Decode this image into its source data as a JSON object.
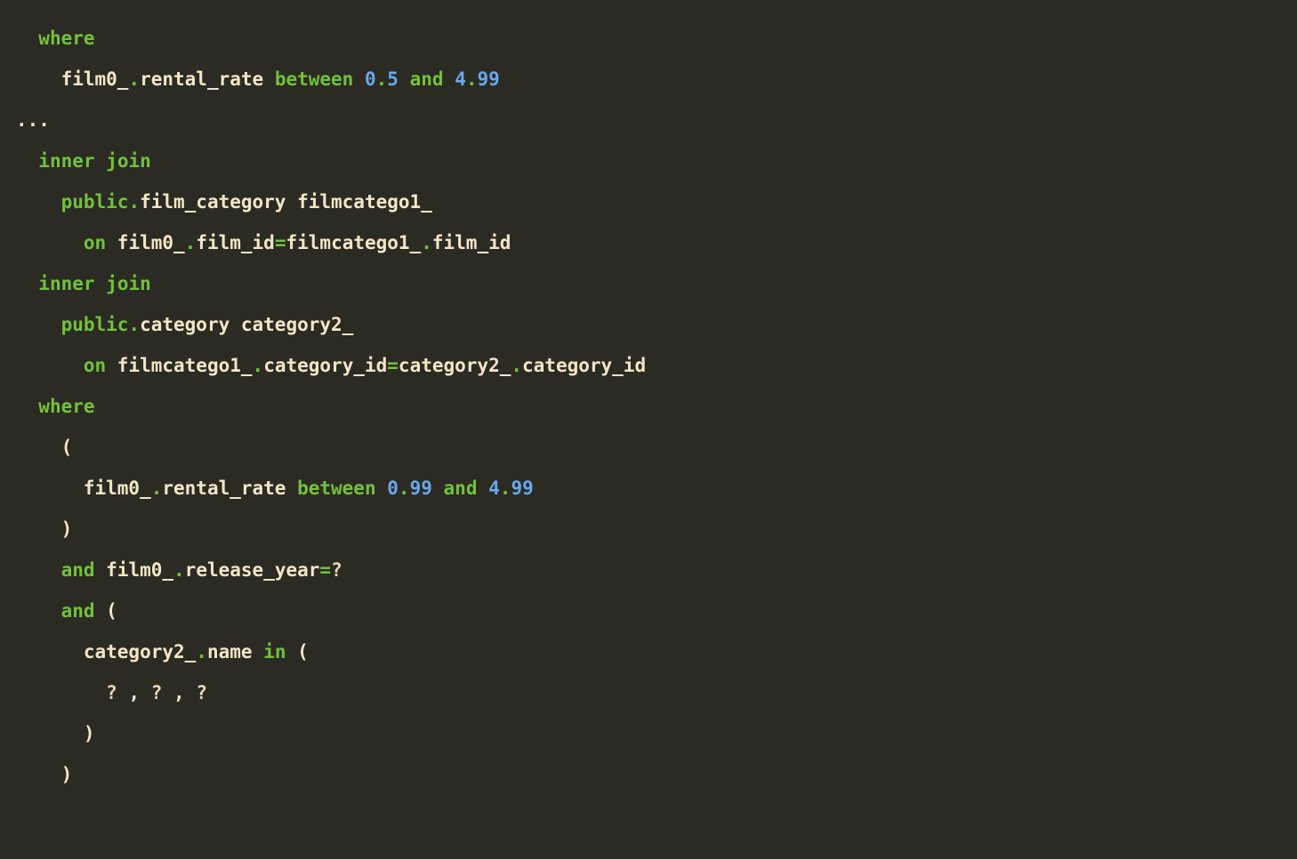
{
  "colors": {
    "bg": "#2b2b24",
    "text": "#e6dfc7",
    "keyword": "#72c23a",
    "number": "#6aa8ec"
  },
  "code_tokens": [
    [
      {
        "t": "  ",
        "c": "pn"
      },
      {
        "t": "where",
        "c": "kw"
      }
    ],
    [
      {
        "t": "    film0_",
        "c": "pn"
      },
      {
        "t": ".",
        "c": "kw"
      },
      {
        "t": "rental_rate ",
        "c": "pn"
      },
      {
        "t": "between",
        "c": "kw"
      },
      {
        "t": " ",
        "c": "pn"
      },
      {
        "t": "0",
        "c": "num"
      },
      {
        "t": ".",
        "c": "kw"
      },
      {
        "t": "5",
        "c": "num"
      },
      {
        "t": " ",
        "c": "pn"
      },
      {
        "t": "and",
        "c": "kw"
      },
      {
        "t": " ",
        "c": "pn"
      },
      {
        "t": "4",
        "c": "num"
      },
      {
        "t": ".",
        "c": "kw"
      },
      {
        "t": "99",
        "c": "num"
      }
    ],
    [
      {
        "t": "...",
        "c": "pn"
      }
    ],
    [
      {
        "t": "  ",
        "c": "pn"
      },
      {
        "t": "inner",
        "c": "kw"
      },
      {
        "t": " ",
        "c": "pn"
      },
      {
        "t": "join",
        "c": "kw"
      }
    ],
    [
      {
        "t": "    ",
        "c": "pn"
      },
      {
        "t": "public",
        "c": "kw"
      },
      {
        "t": ".",
        "c": "kw"
      },
      {
        "t": "film_category filmcatego1_",
        "c": "pn"
      }
    ],
    [
      {
        "t": "      ",
        "c": "pn"
      },
      {
        "t": "on",
        "c": "kw"
      },
      {
        "t": " film0_",
        "c": "pn"
      },
      {
        "t": ".",
        "c": "kw"
      },
      {
        "t": "film_id",
        "c": "pn"
      },
      {
        "t": "=",
        "c": "kw"
      },
      {
        "t": "filmcatego1_",
        "c": "pn"
      },
      {
        "t": ".",
        "c": "kw"
      },
      {
        "t": "film_id",
        "c": "pn"
      }
    ],
    [
      {
        "t": "  ",
        "c": "pn"
      },
      {
        "t": "inner",
        "c": "kw"
      },
      {
        "t": " ",
        "c": "pn"
      },
      {
        "t": "join",
        "c": "kw"
      }
    ],
    [
      {
        "t": "    ",
        "c": "pn"
      },
      {
        "t": "public",
        "c": "kw"
      },
      {
        "t": ".",
        "c": "kw"
      },
      {
        "t": "category category2_",
        "c": "pn"
      }
    ],
    [
      {
        "t": "      ",
        "c": "pn"
      },
      {
        "t": "on",
        "c": "kw"
      },
      {
        "t": " filmcatego1_",
        "c": "pn"
      },
      {
        "t": ".",
        "c": "kw"
      },
      {
        "t": "category_id",
        "c": "pn"
      },
      {
        "t": "=",
        "c": "kw"
      },
      {
        "t": "category2_",
        "c": "pn"
      },
      {
        "t": ".",
        "c": "kw"
      },
      {
        "t": "category_id",
        "c": "pn"
      }
    ],
    [
      {
        "t": "  ",
        "c": "pn"
      },
      {
        "t": "where",
        "c": "kw"
      }
    ],
    [
      {
        "t": "    (",
        "c": "pn"
      }
    ],
    [
      {
        "t": "      film0_",
        "c": "pn"
      },
      {
        "t": ".",
        "c": "kw"
      },
      {
        "t": "rental_rate ",
        "c": "pn"
      },
      {
        "t": "between",
        "c": "kw"
      },
      {
        "t": " ",
        "c": "pn"
      },
      {
        "t": "0",
        "c": "num"
      },
      {
        "t": ".",
        "c": "kw"
      },
      {
        "t": "99",
        "c": "num"
      },
      {
        "t": " ",
        "c": "pn"
      },
      {
        "t": "and",
        "c": "kw"
      },
      {
        "t": " ",
        "c": "pn"
      },
      {
        "t": "4",
        "c": "num"
      },
      {
        "t": ".",
        "c": "kw"
      },
      {
        "t": "99",
        "c": "num"
      }
    ],
    [
      {
        "t": "    )",
        "c": "pn"
      }
    ],
    [
      {
        "t": "    ",
        "c": "pn"
      },
      {
        "t": "and",
        "c": "kw"
      },
      {
        "t": " film0_",
        "c": "pn"
      },
      {
        "t": ".",
        "c": "kw"
      },
      {
        "t": "release_year",
        "c": "pn"
      },
      {
        "t": "=",
        "c": "kw"
      },
      {
        "t": "?",
        "c": "q"
      }
    ],
    [
      {
        "t": "    ",
        "c": "pn"
      },
      {
        "t": "and",
        "c": "kw"
      },
      {
        "t": " (",
        "c": "pn"
      }
    ],
    [
      {
        "t": "      category2_",
        "c": "pn"
      },
      {
        "t": ".",
        "c": "kw"
      },
      {
        "t": "name ",
        "c": "pn"
      },
      {
        "t": "in",
        "c": "kw"
      },
      {
        "t": " (",
        "c": "pn"
      }
    ],
    [
      {
        "t": "        ",
        "c": "pn"
      },
      {
        "t": "?",
        "c": "q"
      },
      {
        "t": " , ",
        "c": "pn"
      },
      {
        "t": "?",
        "c": "q"
      },
      {
        "t": " , ",
        "c": "pn"
      },
      {
        "t": "?",
        "c": "q"
      }
    ],
    [
      {
        "t": "      )",
        "c": "pn"
      }
    ],
    [
      {
        "t": "    )",
        "c": "pn"
      }
    ]
  ]
}
